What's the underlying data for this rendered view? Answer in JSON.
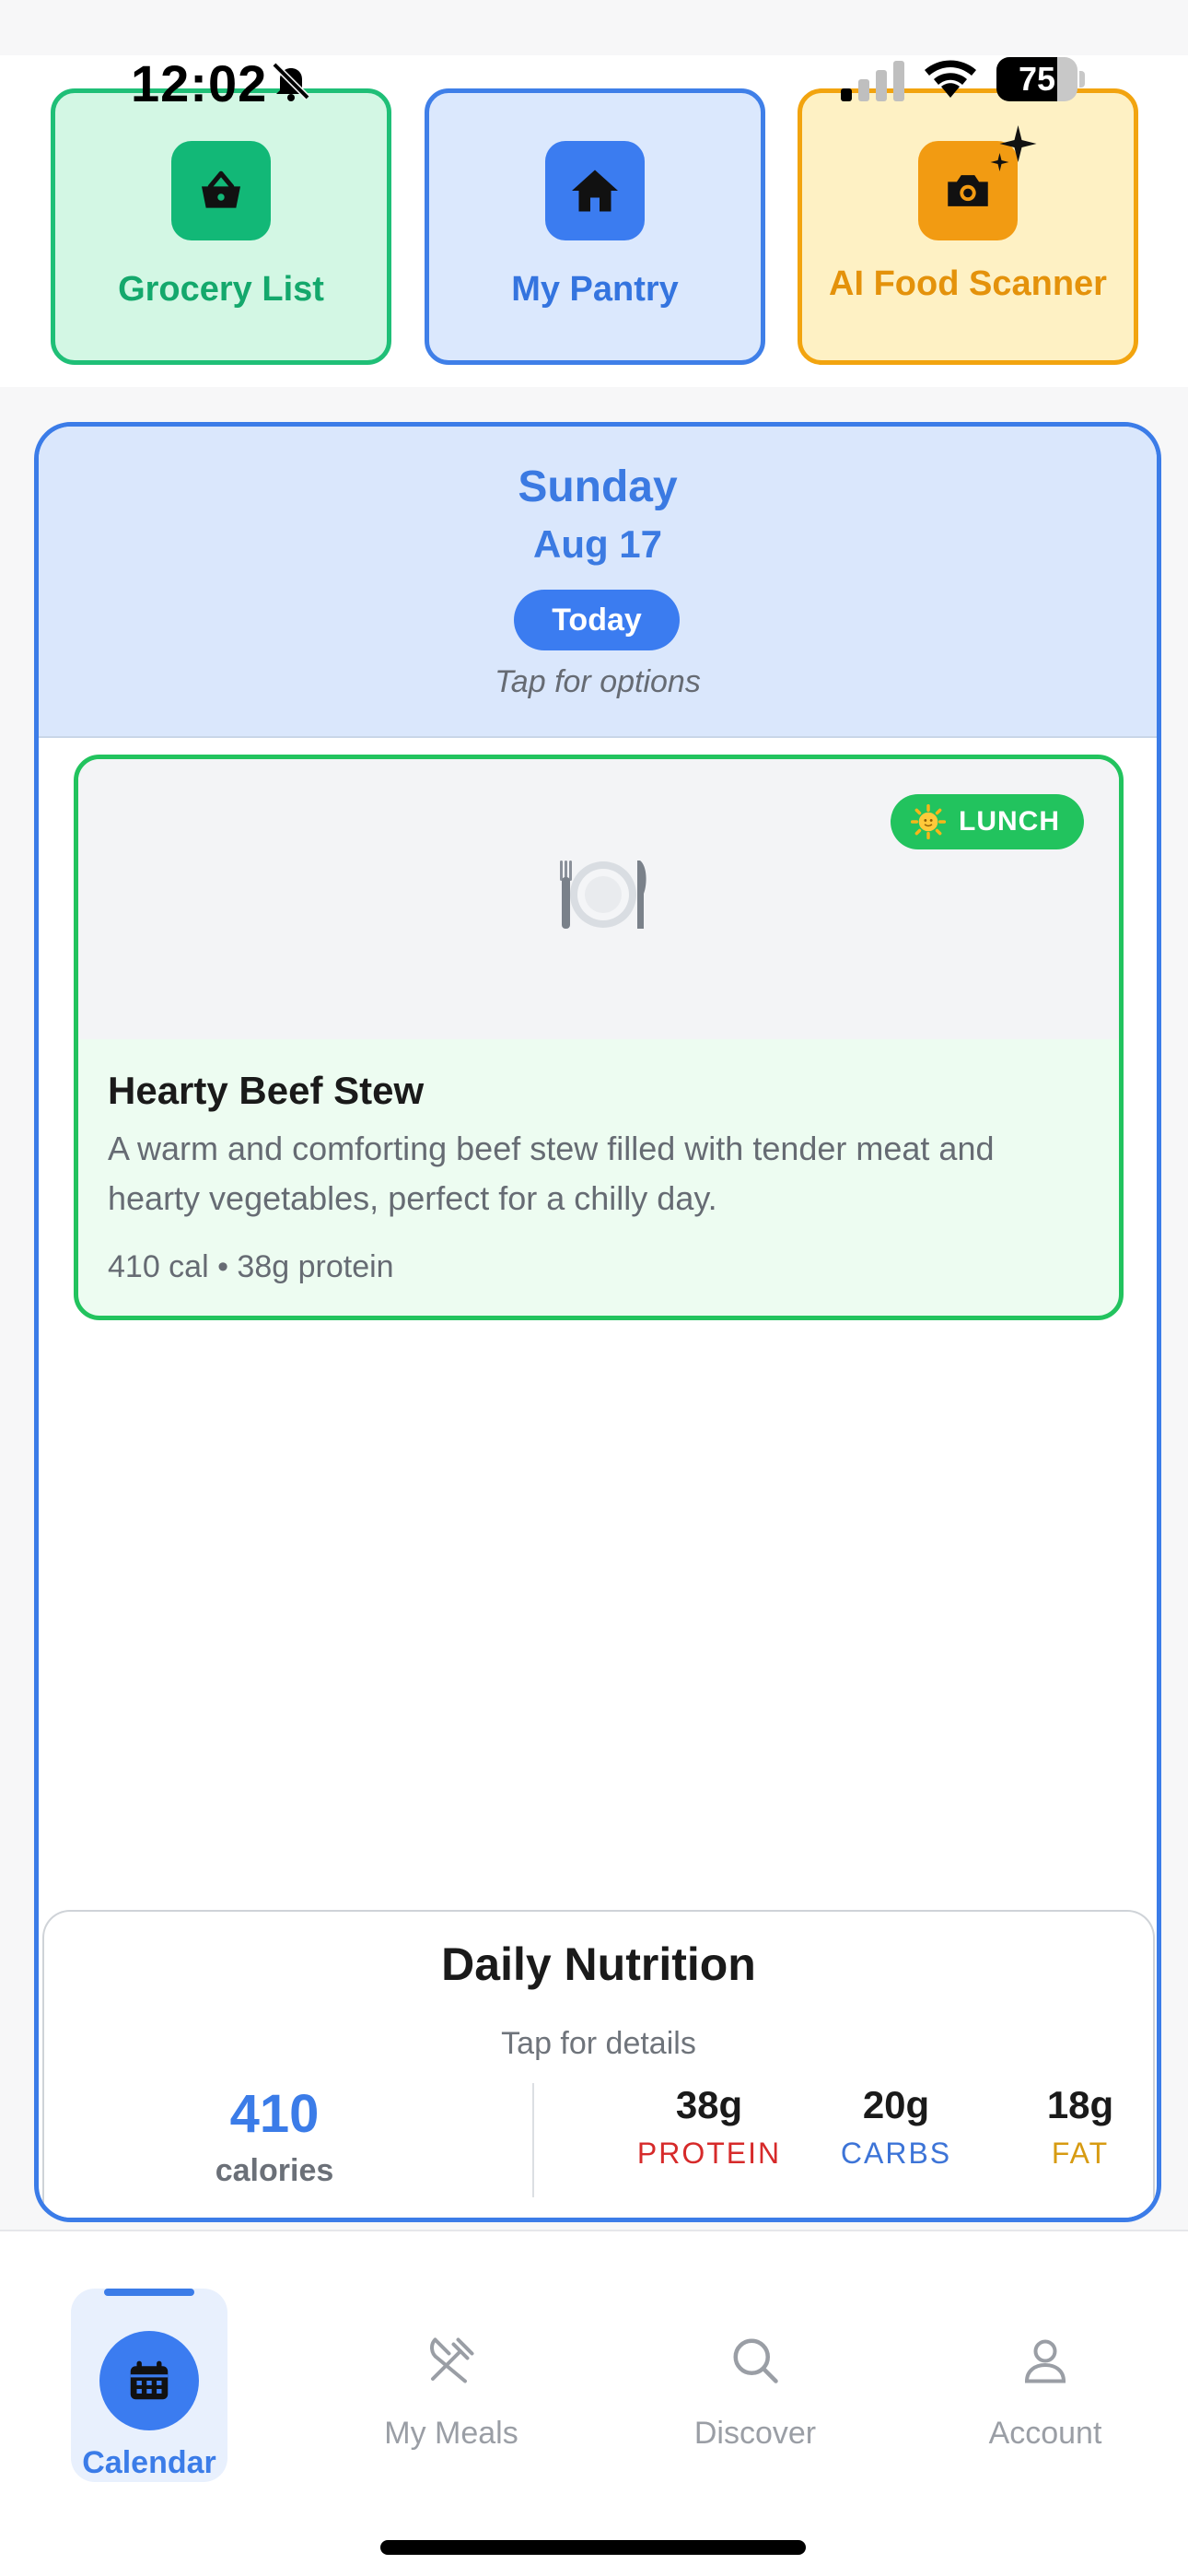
{
  "status_bar": {
    "time": "12:02",
    "battery": "75",
    "battery_level": 0.75
  },
  "quick_actions": [
    {
      "label": "Grocery List",
      "icon": "basket-icon"
    },
    {
      "label": "My Pantry",
      "icon": "house-icon"
    },
    {
      "label": "AI Food Scanner",
      "icon": "camera-sparkle-icon"
    }
  ],
  "day": {
    "name": "Sunday",
    "date": "Aug 17",
    "today_label": "Today",
    "hint": "Tap for options"
  },
  "meal": {
    "badge": "LUNCH",
    "badge_icon": "sun-icon",
    "title": "Hearty Beef Stew",
    "description": "A warm and comforting beef stew filled with tender meat and hearty vegetables, perfect for a chilly day.",
    "macros": "410 cal • 38g protein",
    "image_icon": "plate-icon"
  },
  "nutrition": {
    "title": "Daily Nutrition",
    "hint": "Tap for details",
    "calories_value": "410",
    "calories_label": "calories",
    "protein_value": "38g",
    "protein_label": "PROTEIN",
    "carbs_value": "20g",
    "carbs_label": "CARBS",
    "fat_value": "18g",
    "fat_label": "FAT"
  },
  "nav": {
    "calendar": "Calendar",
    "meals": "My Meals",
    "discover": "Discover",
    "account": "Account"
  },
  "colors": {
    "accent": "#3b7ce8",
    "green": "#22c35e",
    "orange": "#f29b12",
    "protein": "#d62a2a",
    "carbs": "#3d74d7",
    "fat": "#d79b12"
  }
}
